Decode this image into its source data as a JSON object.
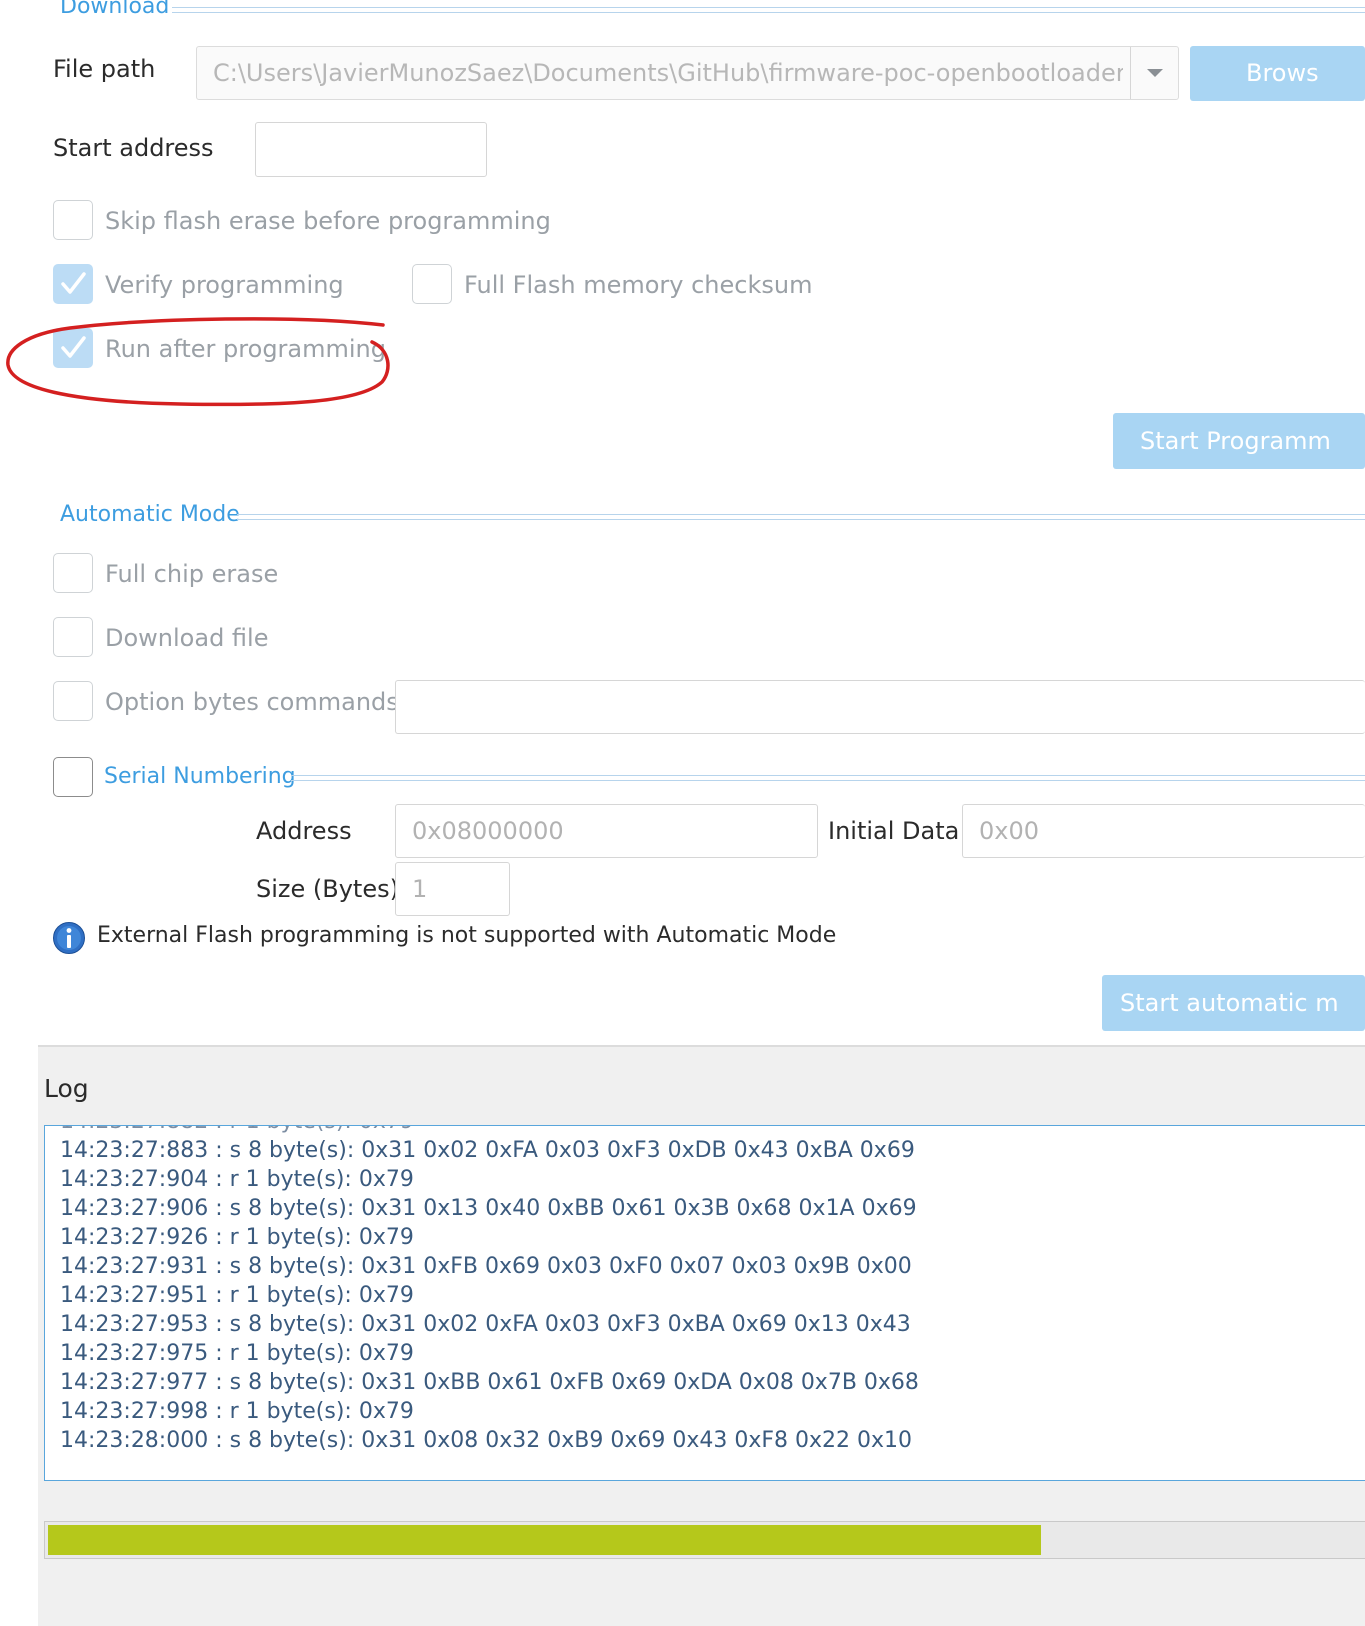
{
  "download": {
    "title": "Download",
    "file_path_label": "File path",
    "file_path_value": "C:\\Users\\JavierMunozSaez\\Documents\\GitHub\\firmware-poc-openbootloader-t",
    "browse_label": "Brows",
    "start_address_label": "Start address",
    "start_address_value": "",
    "skip_erase_label": "Skip flash erase before programming",
    "skip_erase_checked": false,
    "verify_label": "Verify programming",
    "verify_checked": true,
    "full_checksum_label": "Full Flash memory checksum",
    "full_checksum_checked": false,
    "run_after_label": "Run after programming",
    "run_after_checked": true,
    "start_programming_label": "Start Programm"
  },
  "automatic_mode": {
    "title": "Automatic Mode",
    "full_chip_erase_label": "Full chip erase",
    "download_file_label": "Download file",
    "option_bytes_label": "Option bytes commands",
    "option_bytes_value": "",
    "serial_numbering": {
      "title": "Serial Numbering",
      "address_label": "Address",
      "address_placeholder": "0x08000000",
      "initial_data_label": "Initial Data",
      "initial_data_placeholder": "0x00",
      "size_label": "Size (Bytes)",
      "size_placeholder": "1"
    },
    "info_text": "External Flash programming is not supported with Automatic Mode",
    "start_automatic_label": "Start automatic m"
  },
  "log": {
    "title": "Log",
    "lines": [
      "14:23:27:883 : s 8 byte(s): 0x31 0x02 0xFA 0x03 0xF3 0xDB 0x43 0xBA 0x69",
      "14:23:27:904 : r 1 byte(s): 0x79",
      "14:23:27:906 : s 8 byte(s): 0x31 0x13 0x40 0xBB 0x61 0x3B 0x68 0x1A 0x69",
      "14:23:27:926 : r 1 byte(s): 0x79",
      "14:23:27:931 : s 8 byte(s): 0x31 0xFB 0x69 0x03 0xF0 0x07 0x03 0x9B 0x00",
      "14:23:27:951 : r 1 byte(s): 0x79",
      "14:23:27:953 : s 8 byte(s): 0x31 0x02 0xFA 0x03 0xF3 0xBA 0x69 0x13 0x43",
      "14:23:27:975 : r 1 byte(s): 0x79",
      "14:23:27:977 : s 8 byte(s): 0x31 0xBB 0x61 0xFB 0x69 0xDA 0x08 0x7B 0x68",
      "14:23:27:998 : r 1 byte(s): 0x79",
      "14:23:28:000 : s 8 byte(s): 0x31 0x08 0x32 0xB9 0x69 0x43 0xF8 0x22 0x10"
    ],
    "progress": 0.75
  },
  "colors": {
    "accent": "#3d9de0",
    "button_disabled": "#a9d5f3",
    "progress_fill": "#b5c81b",
    "annotation": "#d42020"
  },
  "icons": {
    "dropdown": "chevron-down-icon",
    "info": "info-icon",
    "check": "checkmark-icon"
  }
}
